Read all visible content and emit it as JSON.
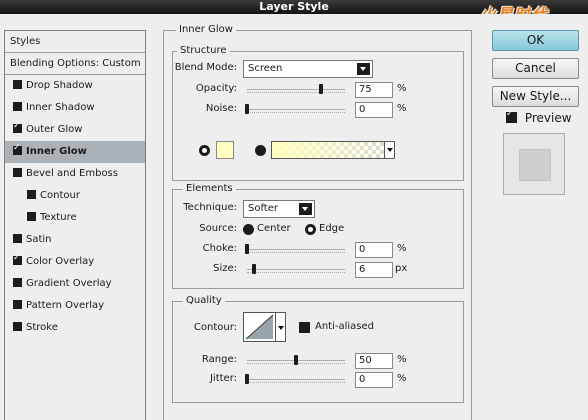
{
  "window": {
    "title": "Layer Style",
    "watermark": "火星时代"
  },
  "stylelist": {
    "header": "Styles",
    "blending": "Blending Options: Custom",
    "items": [
      {
        "label": "Drop Shadow",
        "checked": false
      },
      {
        "label": "Inner Shadow",
        "checked": false
      },
      {
        "label": "Outer Glow",
        "checked": true
      },
      {
        "label": "Inner Glow",
        "checked": true
      },
      {
        "label": "Bevel and Emboss",
        "checked": false
      },
      {
        "label": "Contour",
        "checked": false
      },
      {
        "label": "Texture",
        "checked": false
      },
      {
        "label": "Satin",
        "checked": false
      },
      {
        "label": "Color Overlay",
        "checked": true
      },
      {
        "label": "Gradient Overlay",
        "checked": false
      },
      {
        "label": "Pattern Overlay",
        "checked": false
      },
      {
        "label": "Stroke",
        "checked": false
      }
    ]
  },
  "panel": {
    "title": "Inner Glow",
    "structure": {
      "title": "Structure",
      "blend_mode_label": "Blend Mode:",
      "blend_mode_value": "Screen",
      "opacity_label": "Opacity:",
      "opacity_value": "75",
      "noise_label": "Noise:",
      "noise_value": "0",
      "unit": "%",
      "glow_color": "#ffffbf"
    },
    "elements": {
      "title": "Elements",
      "technique_label": "Technique:",
      "technique_value": "Softer",
      "source_label": "Source:",
      "source_center": "Center",
      "source_edge": "Edge",
      "source_selected": "Edge",
      "choke_label": "Choke:",
      "choke_value": "0",
      "size_label": "Size:",
      "size_value": "6",
      "pct": "%",
      "px": "px"
    },
    "quality": {
      "title": "Quality",
      "contour_label": "Contour:",
      "anti_aliased_label": "Anti-aliased",
      "anti_aliased": false,
      "range_label": "Range:",
      "range_value": "50",
      "jitter_label": "Jitter:",
      "jitter_value": "0",
      "pct": "%"
    }
  },
  "buttons": {
    "ok": "OK",
    "cancel": "Cancel",
    "new_style": "New Style...",
    "preview_label": "Preview",
    "preview_checked": true
  }
}
